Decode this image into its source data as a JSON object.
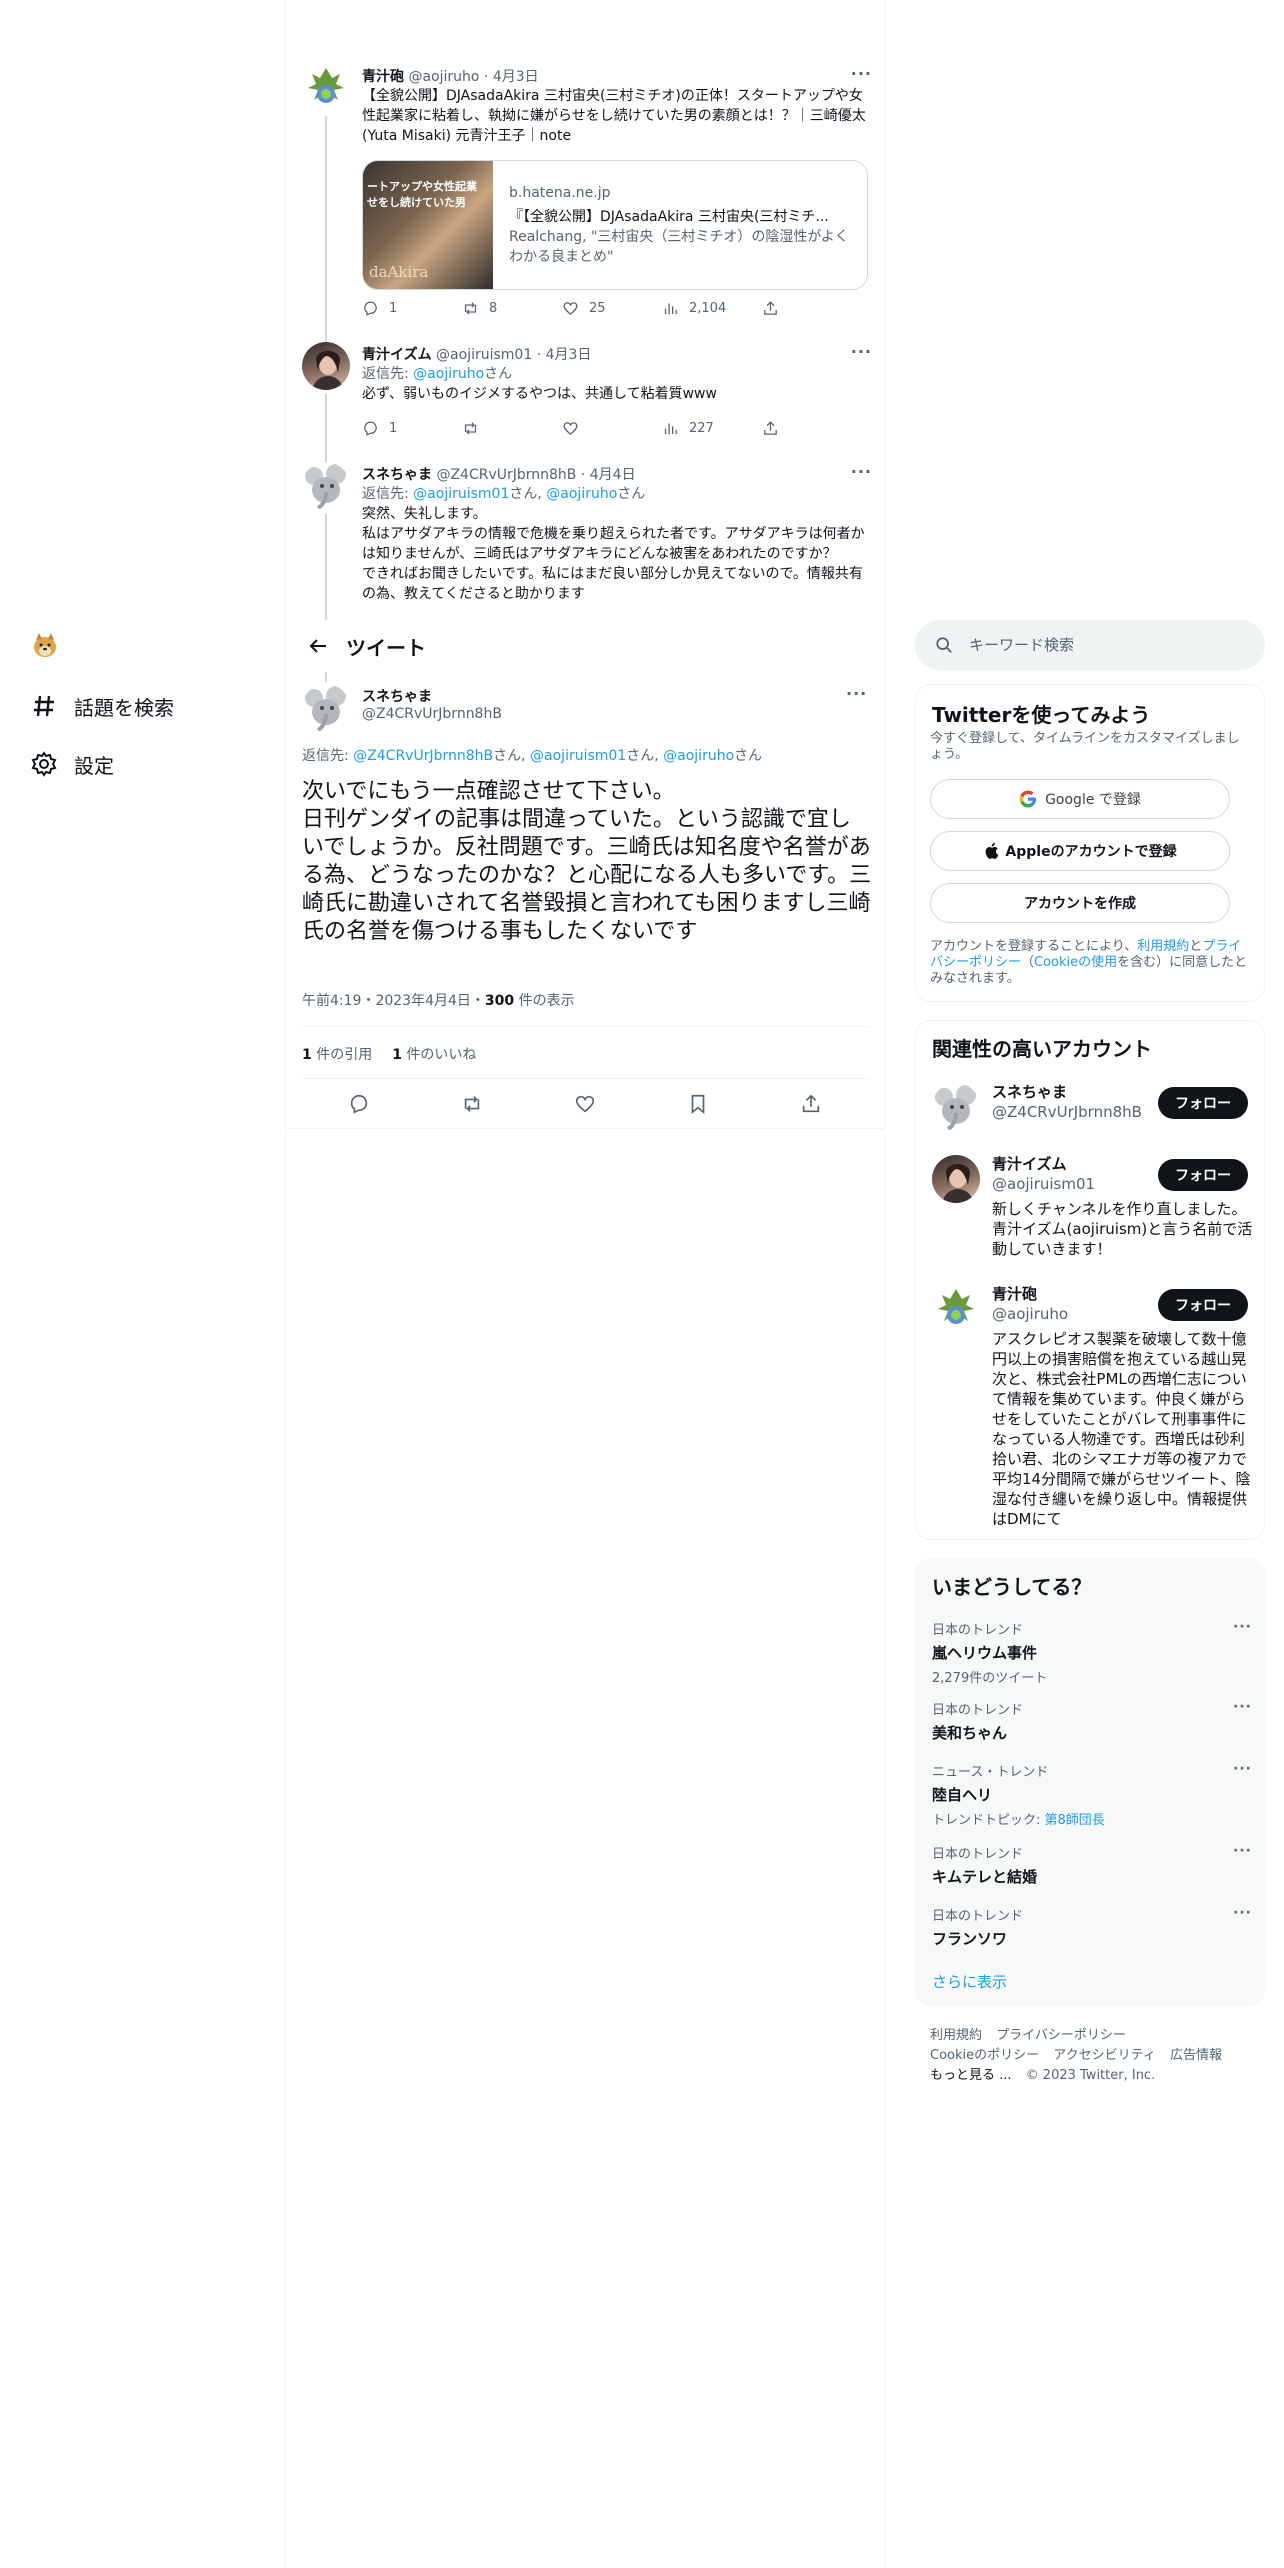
{
  "nav": {
    "items": [
      {
        "label": "話題を検索"
      },
      {
        "label": "設定"
      }
    ]
  },
  "thread": [
    {
      "name": "青汁砲",
      "handle": "@aojiruho",
      "time": "4月3日",
      "text": "【全貌公開】DJAsadaAkira 三村宙央(三村ミチオ)の正体！スタートアップや女性起業家に粘着し、執拗に嫌がらせをし続けていた男の素顔とは！？｜三崎優太(Yuta Misaki) 元青汁王子｜note",
      "card": {
        "image_text": "ートアップや女性起業\nせをし続けていた男",
        "image_logo": "daAkira",
        "domain": "b.hatena.ne.jp",
        "title": "『【全貌公開】DJAsadaAkira 三村宙央(三村ミチ...",
        "desc": "Realchang, \"三村宙央（三村ミチオ）の陰湿性がよくわかる良まとめ\""
      },
      "replies": "1",
      "retweets": "8",
      "likes": "25",
      "views": "2,104"
    },
    {
      "name": "青汁イズム",
      "handle": "@aojiruism01",
      "time": "4月3日",
      "reply_prefix": "返信先: ",
      "reply_handle": "@aojiruho",
      "reply_suffix": "さん",
      "text": "必ず、弱いものイジメするやつは、共通して粘着質www",
      "replies": "1",
      "retweets": "",
      "likes": "",
      "views": "227"
    },
    {
      "name": "スネちゃま",
      "handle": "@Z4CRvUrJbrnn8hB",
      "time": "4月4日",
      "reply_prefix": "返信先: ",
      "reply_handle_1": "@aojiruism01",
      "reply_mid": "さん, ",
      "reply_handle_2": "@aojiruho",
      "reply_suffix": "さん",
      "text_lines": [
        "突然、失礼します。",
        "私はアサダアキラの情報で危機を乗り超えられた者です。アサダアキラは何者かは知りませんが、三崎氏はアサダアキラにどんな被害をあわれたのですか？",
        "できればお聞きしたいです。私にはまだ良い部分しか見えてないので。情報共有の為、教えてくださると助かります"
      ]
    }
  ],
  "header": {
    "title": "ツイート"
  },
  "main_tweet": {
    "name": "スネちゃま",
    "handle": "@Z4CRvUrJbrnn8hB",
    "reply_prefix": "返信先: ",
    "reply_handle_1": "@Z4CRvUrJbrnn8hB",
    "reply_sep_1": "さん, ",
    "reply_handle_2": "@aojiruism01",
    "reply_sep_2": "さん, ",
    "reply_handle_3": "@aojiruho",
    "reply_suffix": "さん",
    "text": "次いでにもう一点確認させて下さい。\n日刊ゲンダイの記事は間違っていた。という認識で宜しいでしょうか。反社問題です。三崎氏は知名度や名誉がある為、どうなったのかな？と心配になる人も多いです。三崎氏に勘違いされて名誉毀損と言われても困りますし三崎氏の名誉を傷つける事もしたくないです",
    "time": "午前4:19・2023年4月4日・",
    "views_count": "300",
    "views_label": " 件の表示",
    "quotes_count": "1",
    "quotes_label": " 件の引用",
    "likes_count": "1",
    "likes_label": " 件のいいね"
  },
  "search": {
    "placeholder": "キーワード検索"
  },
  "signup": {
    "title": "Twitterを使ってみよう",
    "subtitle": "今すぐ登録して、タイムラインをカスタマイズしましょう。",
    "google": "Google で登録",
    "apple": "Appleのアカウントで登録",
    "create": "アカウントを作成",
    "terms_1": "アカウントを登録することにより、",
    "terms_link_1": "利用規約",
    "terms_2": "と",
    "terms_link_2": "プライバシーポリシー",
    "terms_3": "（",
    "terms_link_3": "Cookieの使用",
    "terms_4": "を含む）に同意したとみなされます。"
  },
  "related": {
    "title": "関連性の高いアカウント",
    "follow_label": "フォロー",
    "accounts": [
      {
        "name": "スネちゃま",
        "handle": "@Z4CRvUrJbrnn8hB",
        "bio": ""
      },
      {
        "name": "青汁イズム",
        "handle": "@aojiruism01",
        "bio": "新しくチャンネルを作り直しました。青汁イズム(aojiruism)と言う名前で活動していきます！"
      },
      {
        "name": "青汁砲",
        "handle": "@aojiruho",
        "bio": "アスクレピオス製薬を破壊して数十億円以上の損害賠償を抱えている越山晃次と、株式会社PMLの西増仁志について情報を集めています。仲良く嫌がらせをしていたことがバレて刑事事件になっている人物達です。西増氏は砂利拾い君、北のシマエナガ等の複アカで平均14分間隔で嫌がらせツイート、陰湿な付き纏いを繰り返し中。情報提供はDMにて"
      }
    ]
  },
  "trends": {
    "title": "いまどうしてる？",
    "items": [
      {
        "category": "日本のトレンド",
        "name": "嵐ヘリウム事件",
        "sub": "2,279件のツイート"
      },
      {
        "category": "日本のトレンド",
        "name": "美和ちゃん",
        "sub": ""
      },
      {
        "category": "ニュース・トレンド",
        "name": "陸自ヘリ",
        "sub_prefix": "トレンドトピック: ",
        "sub_link": "第8師団長"
      },
      {
        "category": "日本のトレンド",
        "name": "キムテレと結婚",
        "sub": ""
      },
      {
        "category": "日本のトレンド",
        "name": "フランソワ",
        "sub": ""
      }
    ],
    "show_more": "さらに表示"
  },
  "footer": {
    "links": [
      "利用規約",
      "プライバシーポリシー",
      "Cookieのポリシー",
      "アクセシビリティ",
      "広告情報",
      "もっと見る ..."
    ],
    "copyright": "© 2023 Twitter, Inc."
  },
  "colors": {
    "accent": "#1d9bf0",
    "text": "#0f1419",
    "muted": "#536471",
    "border": "#eff3f4"
  }
}
